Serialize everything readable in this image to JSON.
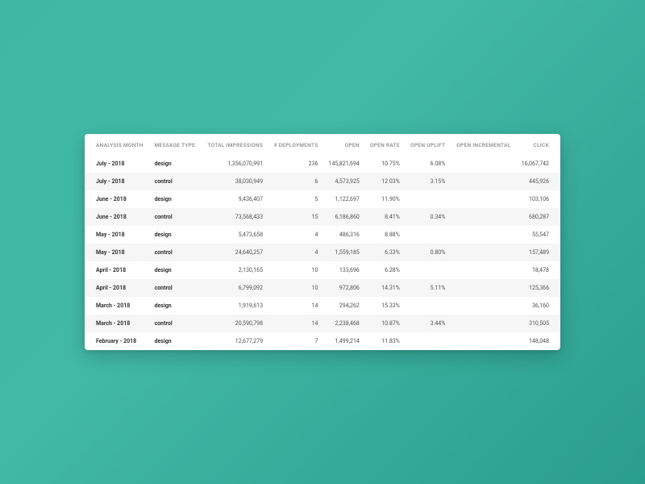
{
  "columns": [
    {
      "key": "analysis_month",
      "label": "ANALYSIS MONTH",
      "type": "text",
      "bold": true
    },
    {
      "key": "message_type",
      "label": "MESSAGE TYPE",
      "type": "text",
      "bold": true
    },
    {
      "key": "total_impressions",
      "label": "TOTAL IMPRESSIONS",
      "type": "num"
    },
    {
      "key": "deployments",
      "label": "# DEPLOYMENTS",
      "type": "num"
    },
    {
      "key": "open",
      "label": "OPEN",
      "type": "num"
    },
    {
      "key": "open_rate",
      "label": "OPEN RATE",
      "type": "num"
    },
    {
      "key": "open_uplift",
      "label": "OPEN UPLIFT",
      "type": "num"
    },
    {
      "key": "open_incremental",
      "label": "OPEN INCREMENTAL",
      "type": "num"
    },
    {
      "key": "click",
      "label": "CLICK",
      "type": "num"
    }
  ],
  "rows": [
    {
      "analysis_month": "July - 2018",
      "message_type": "design",
      "total_impressions": "1,356,070,991",
      "deployments": "236",
      "open": "145,821,694",
      "open_rate": "10.75%",
      "open_uplift": "6.08%",
      "open_incremental": "",
      "click": "16,067,742"
    },
    {
      "analysis_month": "July - 2018",
      "message_type": "control",
      "total_impressions": "38,030,949",
      "deployments": "6",
      "open": "4,573,925",
      "open_rate": "12.03%",
      "open_uplift": "3.15%",
      "open_incremental": "",
      "click": "445,926"
    },
    {
      "analysis_month": "June - 2018",
      "message_type": "design",
      "total_impressions": "9,436,407",
      "deployments": "5",
      "open": "1,122,697",
      "open_rate": "11.90%",
      "open_uplift": "",
      "open_incremental": "",
      "click": "103,106"
    },
    {
      "analysis_month": "June - 2018",
      "message_type": "control",
      "total_impressions": "73,568,433",
      "deployments": "15",
      "open": "6,186,860",
      "open_rate": "8.41%",
      "open_uplift": "0.34%",
      "open_incremental": "",
      "click": "680,287"
    },
    {
      "analysis_month": "May - 2018",
      "message_type": "design",
      "total_impressions": "5,473,658",
      "deployments": "4",
      "open": "486,316",
      "open_rate": "8.88%",
      "open_uplift": "",
      "open_incremental": "",
      "click": "55,547"
    },
    {
      "analysis_month": "May - 2018",
      "message_type": "control",
      "total_impressions": "24,640,257",
      "deployments": "4",
      "open": "1,559,185",
      "open_rate": "6.33%",
      "open_uplift": "0.80%",
      "open_incremental": "",
      "click": "157,489"
    },
    {
      "analysis_month": "April - 2018",
      "message_type": "design",
      "total_impressions": "2,130,165",
      "deployments": "10",
      "open": "133,696",
      "open_rate": "6.28%",
      "open_uplift": "",
      "open_incremental": "",
      "click": "18,478"
    },
    {
      "analysis_month": "April - 2018",
      "message_type": "control",
      "total_impressions": "6,799,092",
      "deployments": "10",
      "open": "972,806",
      "open_rate": "14.31%",
      "open_uplift": "5.11%",
      "open_incremental": "",
      "click": "125,366"
    },
    {
      "analysis_month": "March - 2018",
      "message_type": "design",
      "total_impressions": "1,919,613",
      "deployments": "14",
      "open": "294,262",
      "open_rate": "15.33%",
      "open_uplift": "",
      "open_incremental": "",
      "click": "36,160"
    },
    {
      "analysis_month": "March - 2018",
      "message_type": "control",
      "total_impressions": "20,590,798",
      "deployments": "14",
      "open": "2,238,468",
      "open_rate": "10.87%",
      "open_uplift": "3.44%",
      "open_incremental": "",
      "click": "310,505"
    },
    {
      "analysis_month": "February - 2018",
      "message_type": "design",
      "total_impressions": "12,677,279",
      "deployments": "7",
      "open": "1,499,214",
      "open_rate": "11.83%",
      "open_uplift": "",
      "open_incremental": "",
      "click": "148,048"
    }
  ]
}
